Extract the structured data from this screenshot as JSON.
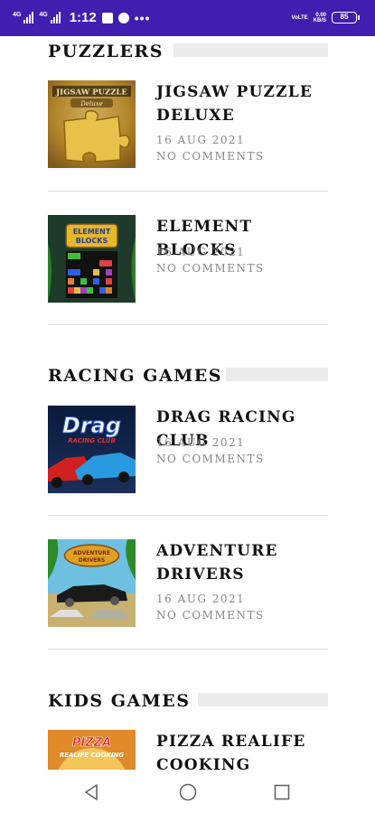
{
  "status_bar": {
    "sim1_label": "4G",
    "sim2_label": "4G",
    "time": "1:12",
    "more_dots": "•••",
    "volte_label": "VoLTE",
    "speed_value": "0.00",
    "speed_unit": "KB/S",
    "battery_level": "85",
    "background_color": "#3f1fb0"
  },
  "sections": [
    {
      "title": "PUZZLERS",
      "posts": [
        {
          "title": "JIGSAW PUZZLE DELUXE",
          "date": "16 AUG 2021",
          "comments": "NO COMMENTS",
          "thumb_text_1": "JIGSAW PUZZLE",
          "thumb_text_2": "Deluxe"
        },
        {
          "title": "ELEMENT BLOCKS",
          "date": "16 AUG 2021",
          "comments": "NO COMMENTS",
          "thumb_text_1": "ELEMENT",
          "thumb_text_2": "BLOCKS"
        }
      ]
    },
    {
      "title": "RACING GAMES",
      "posts": [
        {
          "title": "DRAG RACING CLUB",
          "date": "16 AUG 2021",
          "comments": "NO COMMENTS",
          "thumb_text_1": "Drag",
          "thumb_text_2": "RACING CLUB"
        },
        {
          "title": "ADVENTURE DRIVERS",
          "date": "16 AUG 2021",
          "comments": "NO COMMENTS",
          "thumb_text_1": "ADVENTURE",
          "thumb_text_2": "DRIVERS"
        }
      ]
    },
    {
      "title": "KIDS GAMES",
      "posts": [
        {
          "title": "PIZZA REALIFE COOKING",
          "thumb_text_1": "PIZZA",
          "thumb_text_2": "REALIFE COOKING"
        }
      ]
    }
  ],
  "nav_bar": {
    "back_icon": "triangle-back-icon",
    "home_icon": "circle-home-icon",
    "recents_icon": "square-recents-icon"
  }
}
